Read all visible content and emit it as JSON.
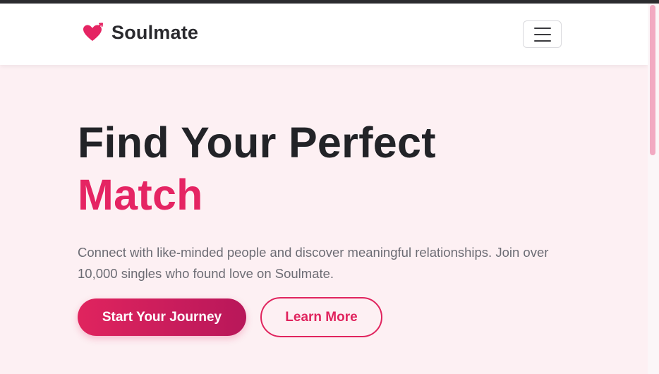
{
  "navbar": {
    "brand_name": "Soulmate",
    "brand_icon": "heart-arrow-icon",
    "menu_icon": "hamburger-menu-icon"
  },
  "hero": {
    "title_line1": "Find Your Perfect",
    "title_accent": "Match",
    "description": "Connect with like-minded people and discover meaningful relationships. Join over 10,000 singles who found love on Soulmate.",
    "primary_button": "Start Your Journey",
    "secondary_button": "Learn More"
  },
  "colors": {
    "accent": "#e0245e",
    "accent_dark": "#b8175a",
    "hero_background": "#fdf0f3",
    "title_text": "#222327",
    "body_text": "#6c6c74"
  }
}
